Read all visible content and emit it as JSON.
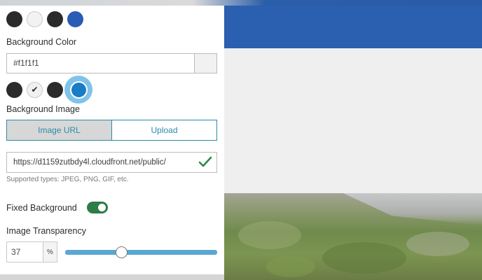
{
  "panel": {
    "text_color_swatches": [
      {
        "color": "#2b2b2b",
        "selected": false
      },
      {
        "color": "#f2f2f2",
        "selected": false
      },
      {
        "color": "#2b2b2b",
        "selected": false
      },
      {
        "color": "#2a5bb5",
        "selected": false
      }
    ],
    "background_color": {
      "label": "Background Color",
      "value": "#f1f1f1",
      "swatches": [
        {
          "color": "#2b2b2b",
          "selected": false,
          "icon": "none"
        },
        {
          "color": "#f1f1f1",
          "selected": false,
          "icon": "check-icon"
        },
        {
          "color": "#2b2b2b",
          "selected": false,
          "icon": "none"
        },
        {
          "color": "#1b7cc6",
          "selected": true,
          "icon": "none"
        }
      ]
    },
    "background_image": {
      "label": "Background Image",
      "tabs": [
        {
          "label": "Image URL",
          "active": true
        },
        {
          "label": "Upload",
          "active": false
        }
      ],
      "url_value": "https://d1159zutbdy4l.cloudfront.net/public/",
      "url_valid_icon": "checkmark-icon",
      "hint": "Supported types: JPEG, PNG, GIF, etc."
    },
    "fixed_background": {
      "label": "Fixed Background",
      "enabled": true,
      "on_color": "#2d7d46"
    },
    "image_transparency": {
      "label": "Image Transparency",
      "value": "37",
      "unit": "%",
      "slider_fraction": 0.37
    }
  },
  "preview": {
    "header_color": "#2b5faf",
    "page_color": "#efefef"
  }
}
